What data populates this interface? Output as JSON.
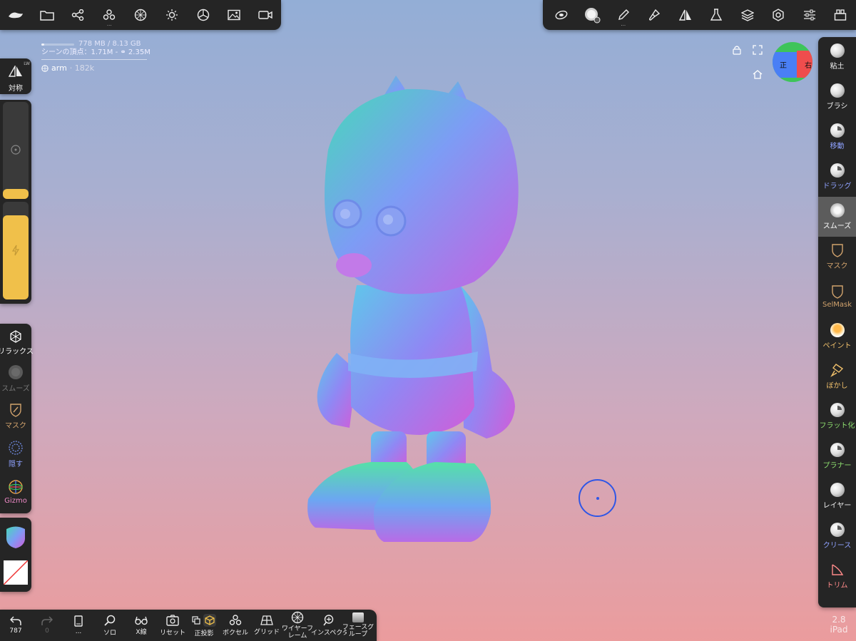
{
  "stats": {
    "memory": "778 MB / 8.13 GB",
    "memory_used_fraction": 0.094,
    "scene_vertices": "シーンの頂点：1.71M - ",
    "scene_faces": "2.35M",
    "object_name": "arm",
    "object_count": "· 182k"
  },
  "left_panel": {
    "symmetry_label": "対称",
    "symmetry_badge": "LW",
    "radius_fraction": 0.27,
    "intensity_fraction": 1.0,
    "tools": [
      {
        "name": "relax",
        "label": "リラックス",
        "icon": "relax-icon"
      },
      {
        "name": "smooth",
        "label": "スムーズ",
        "icon": "smooth-icon"
      },
      {
        "name": "mask",
        "label": "マスク",
        "icon": "mask-icon"
      },
      {
        "name": "hide",
        "label": "隠す",
        "icon": "hide-icon"
      },
      {
        "name": "gizmo",
        "label": "Gizmo",
        "icon": "gizmo-icon"
      }
    ]
  },
  "right_panel": {
    "tools": [
      {
        "name": "clay",
        "label": "粘土",
        "color": "#f0f0f0"
      },
      {
        "name": "brush",
        "label": "ブラシ",
        "color": "#f0f0f0"
      },
      {
        "name": "move",
        "label": "移動",
        "color": "#8fa2ff"
      },
      {
        "name": "drag",
        "label": "ドラッグ",
        "color": "#8fa2ff"
      },
      {
        "name": "smooth",
        "label": "スムーズ",
        "color": "#ffffff"
      },
      {
        "name": "mask",
        "label": "マスク",
        "color": "#d2a36d"
      },
      {
        "name": "selmask",
        "label": "SelMask",
        "color": "#d2a36d"
      },
      {
        "name": "paint",
        "label": "ペイント",
        "color": "#f0c06b"
      },
      {
        "name": "blur",
        "label": "ぼかし",
        "color": "#f0c06b"
      },
      {
        "name": "flatten",
        "label": "フラット化",
        "color": "#8ee070"
      },
      {
        "name": "planar",
        "label": "プラナー",
        "color": "#8ee070"
      },
      {
        "name": "layer",
        "label": "レイヤー",
        "color": "#f0f0f0"
      },
      {
        "name": "crease",
        "label": "クリース",
        "color": "#8fa2ff"
      },
      {
        "name": "trim",
        "label": "トリム",
        "color": "#ff8a8a"
      }
    ]
  },
  "bottom_bar": {
    "undo_count": "787",
    "redo_count": "0",
    "items": [
      {
        "name": "menu",
        "label": "..."
      },
      {
        "name": "solo",
        "label": "ソロ"
      },
      {
        "name": "xray",
        "label": "X線"
      },
      {
        "name": "reset",
        "label": "リセット"
      },
      {
        "name": "ortho",
        "label": "正投影"
      },
      {
        "name": "voxel",
        "label": "ボクセル"
      },
      {
        "name": "grid",
        "label": "グリッド"
      },
      {
        "name": "wireframe",
        "label": "ワイヤーフレーム"
      },
      {
        "name": "inspector",
        "label": "インスペクター"
      },
      {
        "name": "facegroup",
        "label": "フェースグループ"
      }
    ]
  },
  "gizmo_cube": {
    "front_label": "正",
    "right_label": "右"
  },
  "version": {
    "number": "2.8",
    "device": "iPad"
  },
  "colors": {
    "accent": "#f0c04a",
    "panel": "#252525",
    "cursor": "#2f56e6"
  }
}
